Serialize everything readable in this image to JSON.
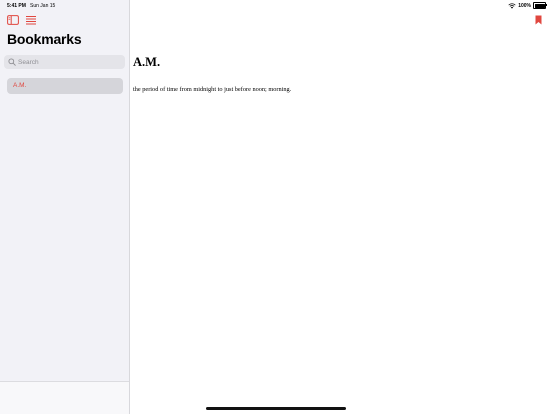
{
  "status_bar": {
    "time": "5:41 PM",
    "date": "Sun Jan 15",
    "battery": "100%"
  },
  "sidebar": {
    "title": "Bookmarks",
    "search_placeholder": "Search",
    "items": [
      {
        "label": "A.M."
      }
    ]
  },
  "main": {
    "term": "A.M.",
    "definition": "the period of time from midnight to just before noon; morning."
  },
  "colors": {
    "accent": "#e0473f",
    "sidebar_bg": "#f2f2f7",
    "selected_item_bg": "#d5d5da"
  },
  "icons": {
    "sidebar_toggle": "sidebar-toggle-icon",
    "list": "list-icon",
    "bookmark": "bookmark-icon",
    "wifi": "wifi-icon",
    "battery": "battery-icon",
    "search": "search-icon"
  }
}
